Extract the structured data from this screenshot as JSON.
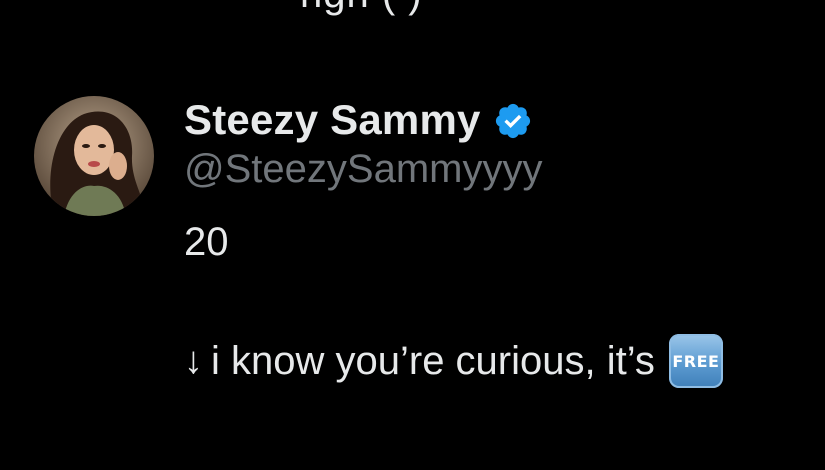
{
  "previous_tweet": {
    "cut_text": "ngn ( )"
  },
  "author": {
    "display_name": "Steezy Sammy",
    "handle": "@SteezySammyyyy",
    "verified": true,
    "verified_color": "#1d9bf0",
    "avatar_icon": "profile-photo"
  },
  "tweet": {
    "line1": "20",
    "line2_arrow": "↓",
    "line2_text": "i know you’re curious, it’s",
    "emoji_label": "FREE",
    "emoji_name": "free-button-emoji"
  },
  "colors": {
    "background": "#000000",
    "text_primary": "#e7e9ea",
    "text_secondary": "#71767b"
  }
}
